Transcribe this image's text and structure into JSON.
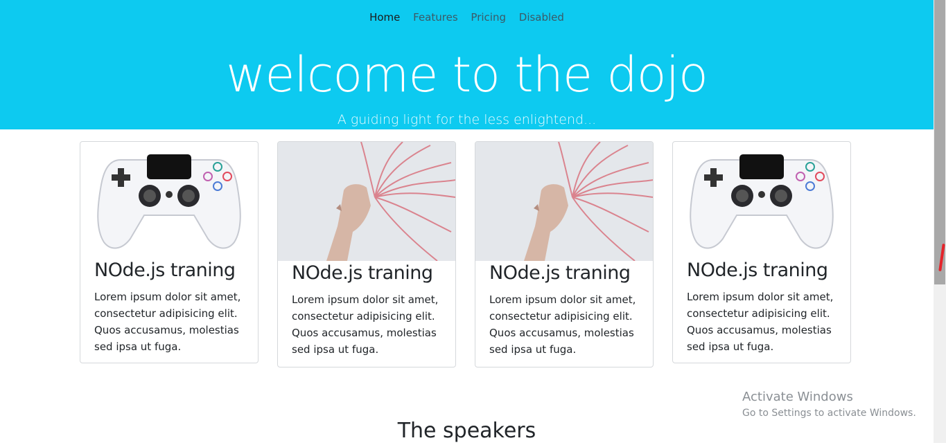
{
  "nav": {
    "items": [
      {
        "label": "Home",
        "active": true
      },
      {
        "label": "Features",
        "active": false
      },
      {
        "label": "Pricing",
        "active": false
      },
      {
        "label": "Disabled",
        "active": false
      }
    ]
  },
  "hero": {
    "title": "welcome to the dojo",
    "subtitle": "A guiding light for the less enlightend..."
  },
  "cards": [
    {
      "image": "gamepad",
      "title": "NOde.js traning",
      "text": "Lorem ipsum dolor sit amet, consectetur adipisicing elit. Quos accusamus, molestias sed ipsa ut fuga."
    },
    {
      "image": "pink-hair-woman",
      "title": "NOde.js traning",
      "text": "Lorem ipsum dolor sit amet, consectetur adipisicing elit. Quos accusamus, molestias sed ipsa ut fuga."
    },
    {
      "image": "pink-hair-woman",
      "title": "NOde.js traning",
      "text": "Lorem ipsum dolor sit amet, consectetur adipisicing elit. Quos accusamus, molestias sed ipsa ut fuga."
    },
    {
      "image": "gamepad",
      "title": "NOde.js traning",
      "text": "Lorem ipsum dolor sit amet, consectetur adipisicing elit. Quos accusamus, molestias sed ipsa ut fuga."
    }
  ],
  "section": {
    "speakers_title": "The speakers"
  },
  "watermark": {
    "line1": "Activate Windows",
    "line2": "Go to Settings to activate Windows."
  },
  "colors": {
    "hero_bg": "#0dcaf0",
    "hair": "#d9727e"
  }
}
